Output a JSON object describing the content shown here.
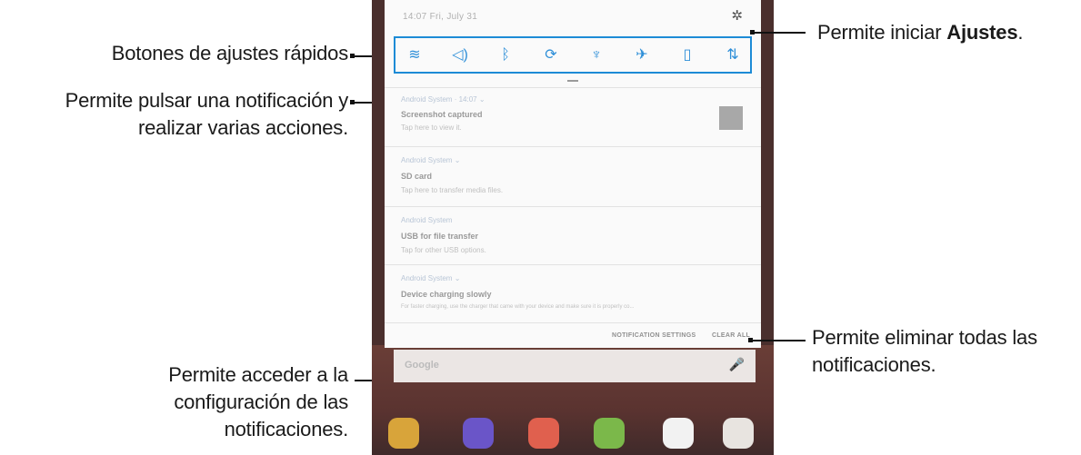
{
  "labels": {
    "quick_settings": "Botones de ajustes rápidos",
    "notification_line1": "Permite pulsar una notificación y",
    "notification_line2": "realizar varias acciones.",
    "settings_prefix": "Permite iniciar ",
    "settings_bold": "Ajustes",
    "settings_suffix": ".",
    "clear_line1": "Permite eliminar todas las",
    "clear_line2": "notificaciones.",
    "notif_settings_line1": "Permite acceder a la",
    "notif_settings_line2": "configuración de las",
    "notif_settings_line3": "notificaciones."
  },
  "panel": {
    "status": "14:07  Fri, July 31",
    "quick_buttons": [
      {
        "icon": "wifi-icon",
        "glyph": "ᯤ"
      },
      {
        "icon": "sound-icon",
        "glyph": "🕪"
      },
      {
        "icon": "bluetooth-icon",
        "glyph": "ᛒ"
      },
      {
        "icon": "auto-rotate-icon",
        "glyph": "⟳"
      },
      {
        "icon": "flashlight-icon",
        "glyph": "♁"
      },
      {
        "icon": "airplane-mode-icon",
        "glyph": "✈"
      },
      {
        "icon": "power-saving-icon",
        "glyph": "▯"
      },
      {
        "icon": "mobile-data-icon",
        "glyph": "⇅"
      }
    ],
    "notifications": [
      {
        "app": "Android System · 14:07 ⌄",
        "title": "Screenshot captured",
        "body": "Tap here to view it."
      },
      {
        "app": "Android System ⌄",
        "title": "SD card",
        "body": "Tap here to transfer media files."
      },
      {
        "app": "Android System",
        "title": "USB for file transfer",
        "body": "Tap for other USB options."
      },
      {
        "app": "Android System ⌄",
        "title": "Device charging slowly",
        "body": "For faster charging, use the charger that came with your device and make sure it is properly co..."
      }
    ],
    "notification_settings": "NOTIFICATION SETTINGS",
    "clear_all": "CLEAR ALL",
    "search_brand": "Google"
  },
  "colors": {
    "accent": "#1d8bd6",
    "wallpaper": "#4a2f2d"
  }
}
